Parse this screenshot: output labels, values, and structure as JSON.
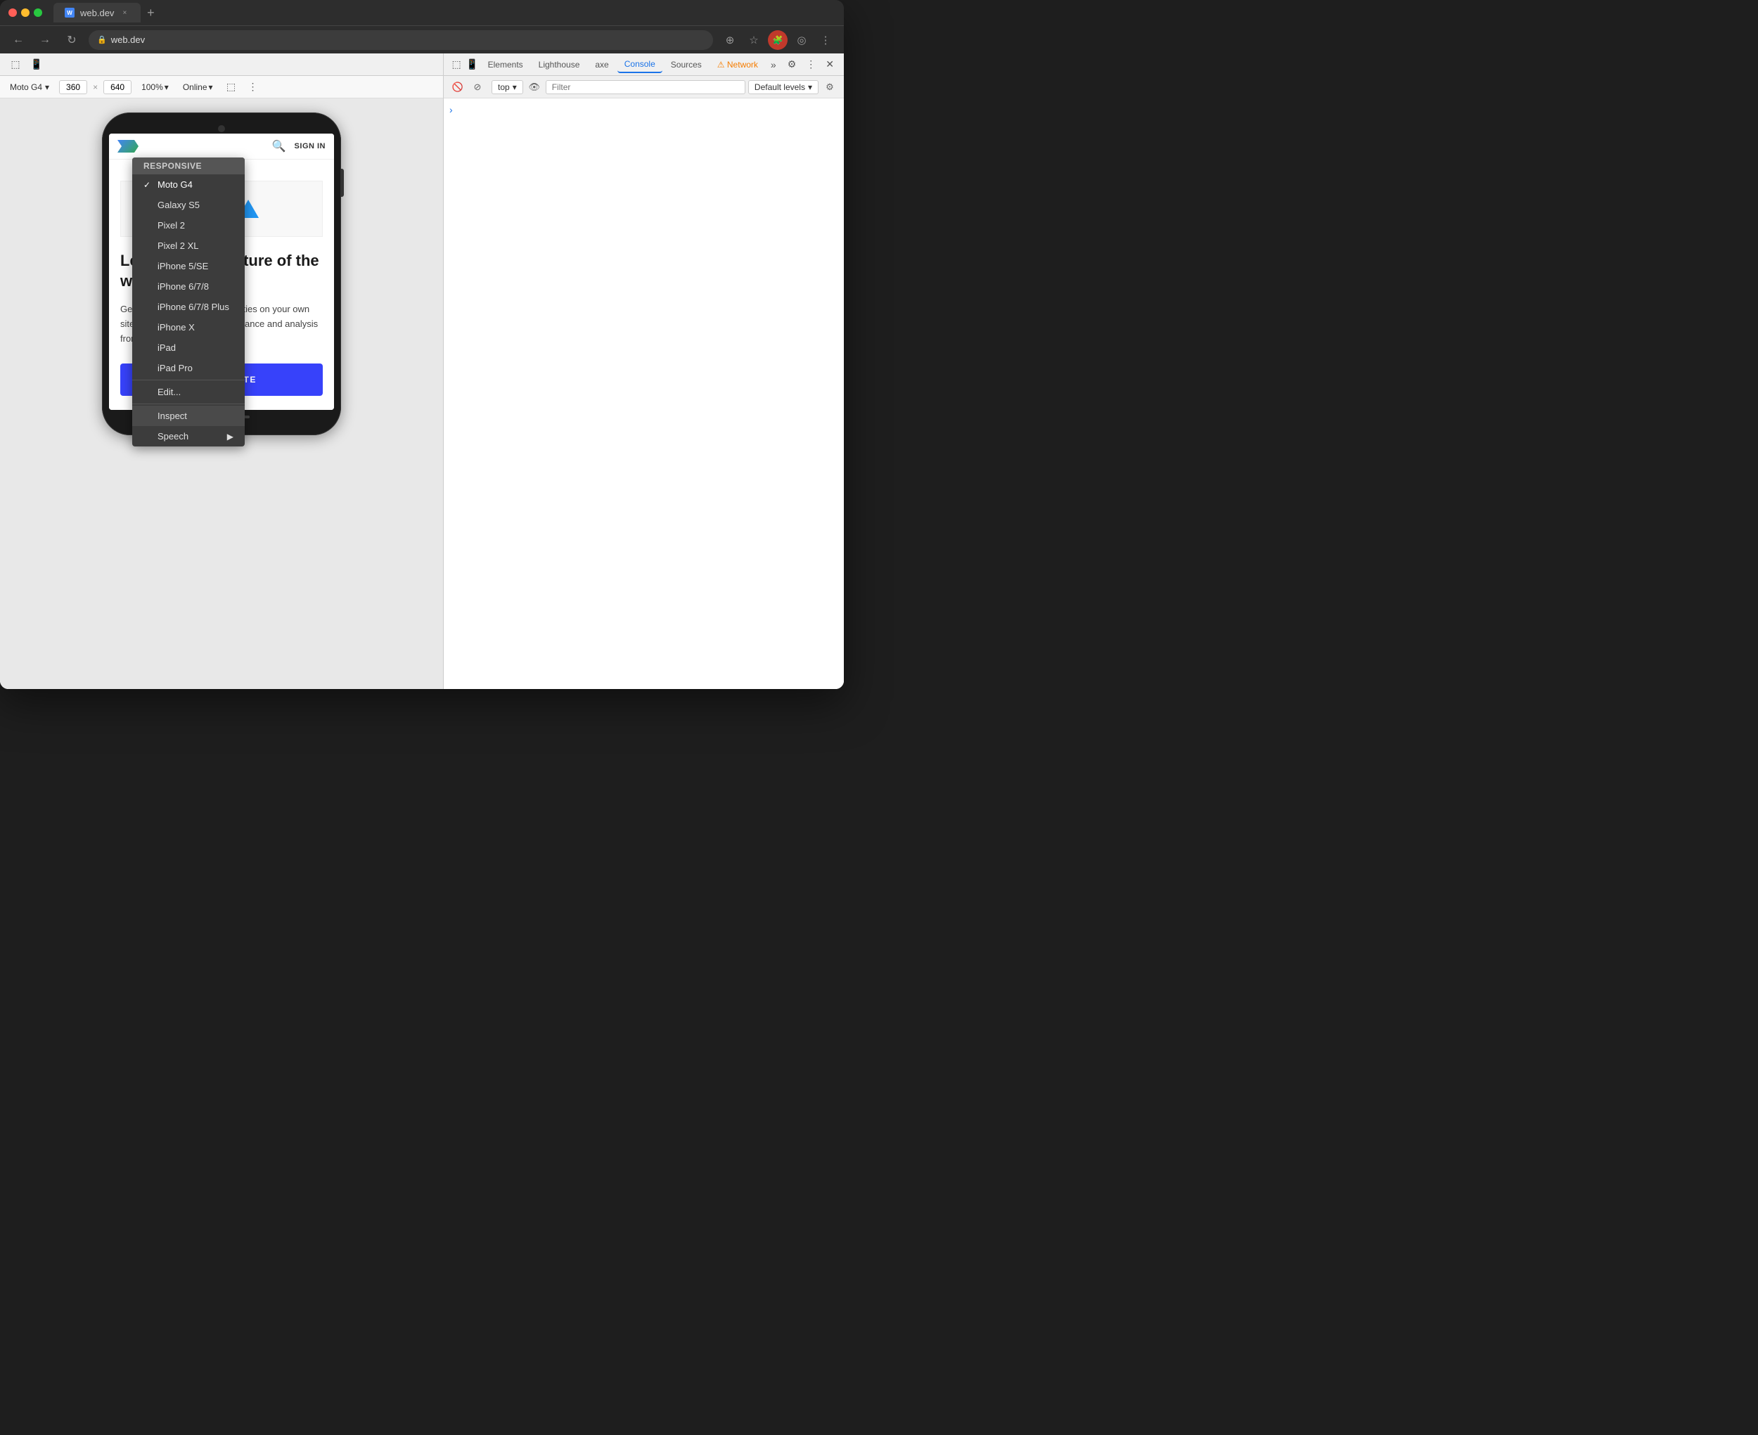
{
  "window": {
    "title": "web.dev",
    "url": "web.dev",
    "favicon": "W"
  },
  "titlebar": {
    "tab_label": "web.dev",
    "new_tab_label": "+",
    "close": "×"
  },
  "addressbar": {
    "back": "←",
    "forward": "→",
    "refresh": "↻",
    "url": "web.dev",
    "plus_icon": "⊕",
    "star_icon": "☆",
    "extension_icon": "🧩",
    "account_icon": "◎",
    "menu_icon": "⋮"
  },
  "responsive_bar": {
    "device": "Moto G4",
    "width": "360",
    "height": "640",
    "zoom": "100%",
    "network": "Online",
    "chevron": "▾",
    "more": "⋮"
  },
  "devtools": {
    "tabs": {
      "elements": "Elements",
      "lighthouse": "Lighthouse",
      "axe": "axe",
      "console": "Console",
      "sources": "Sources",
      "network": "Network"
    },
    "active_tab": "Console",
    "console_bar": {
      "context": "top",
      "filter_placeholder": "Filter",
      "default_levels": "Default levels"
    }
  },
  "dropdown": {
    "section_header": "Responsive",
    "items": [
      {
        "id": "moto-g4",
        "label": "Moto G4",
        "checked": true
      },
      {
        "id": "galaxy-s5",
        "label": "Galaxy S5",
        "checked": false
      },
      {
        "id": "pixel-2",
        "label": "Pixel 2",
        "checked": false
      },
      {
        "id": "pixel-2-xl",
        "label": "Pixel 2 XL",
        "checked": false
      },
      {
        "id": "iphone-5se",
        "label": "iPhone 5/SE",
        "checked": false
      },
      {
        "id": "iphone-678",
        "label": "iPhone 6/7/8",
        "checked": false
      },
      {
        "id": "iphone-678-plus",
        "label": "iPhone 6/7/8 Plus",
        "checked": false
      },
      {
        "id": "iphone-x",
        "label": "iPhone X",
        "checked": false
      },
      {
        "id": "ipad",
        "label": "iPad",
        "checked": false
      },
      {
        "id": "ipad-pro",
        "label": "iPad Pro",
        "checked": false
      }
    ],
    "edit": "Edit...",
    "inspect": "Inspect",
    "speech": "Speech",
    "speech_arrow": "▶"
  },
  "site": {
    "nav": {
      "sign_in": "SIGN IN"
    },
    "hero": {
      "title": "Let's build the future of the web",
      "description": "Get the web's modern capabilities on your own sites and apps with useful guidance and analysis from web.dev.",
      "cta": "TEST MY SITE"
    }
  },
  "icons": {
    "back": "←",
    "forward": "→",
    "refresh": "↻",
    "lock": "🔒",
    "chevron_down": "▾",
    "search": "🔍",
    "inspect": "⬚",
    "device": "📱",
    "rotate": "⟲",
    "more": "⋮",
    "close": "✕",
    "gear": "⚙",
    "warning": "⚠",
    "eye": "👁",
    "chevron_right": "›"
  }
}
